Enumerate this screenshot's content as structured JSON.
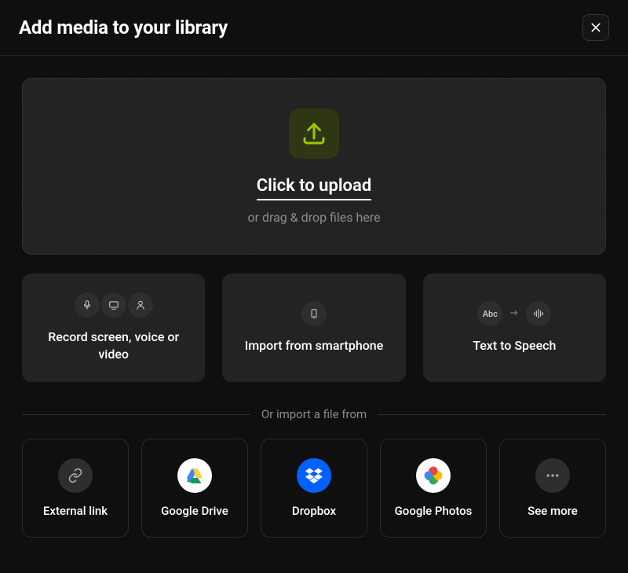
{
  "header": {
    "title": "Add media to your library"
  },
  "dropzone": {
    "click_label": "Click to upload",
    "drag_hint": "or drag & drop files here"
  },
  "actions": {
    "record": {
      "label": "Record screen, voice or video"
    },
    "smartphone": {
      "label": "Import from smartphone"
    },
    "tts": {
      "label": "Text to Speech",
      "abc": "Abc"
    }
  },
  "divider": {
    "label": "Or import a file from"
  },
  "sources": {
    "external": {
      "label": "External link"
    },
    "gdrive": {
      "label": "Google Drive"
    },
    "dropbox": {
      "label": "Dropbox"
    },
    "gphotos": {
      "label": "Google Photos"
    },
    "more": {
      "label": "See more"
    }
  }
}
